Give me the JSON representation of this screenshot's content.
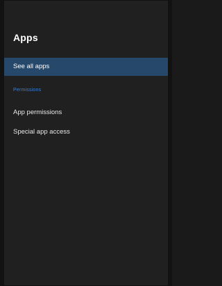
{
  "screen": {
    "title": "Apps",
    "items": [
      {
        "label": "See all apps",
        "selected": true
      },
      {
        "label": "App permissions",
        "selected": false
      },
      {
        "label": "Special app access",
        "selected": false
      }
    ],
    "section_header": "Permissions"
  },
  "colors": {
    "background": "#202020",
    "selected_background": "#26486b",
    "section_header": "#3f7fd1",
    "text": "#ffffff"
  }
}
